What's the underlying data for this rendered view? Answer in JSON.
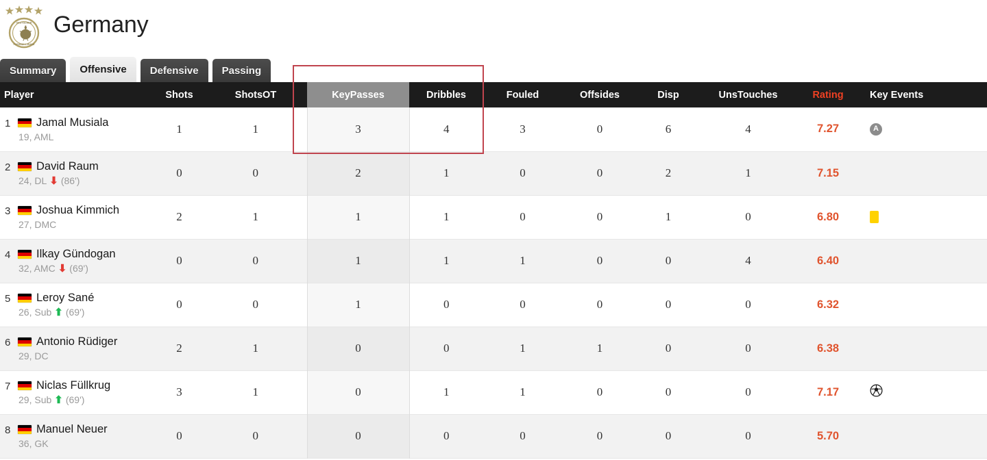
{
  "header": {
    "team": "Germany",
    "crest_icon": "germany-dfb-crest-icon",
    "stars": "★★★★"
  },
  "tabs": [
    {
      "label": "Summary",
      "active": false
    },
    {
      "label": "Offensive",
      "active": true
    },
    {
      "label": "Defensive",
      "active": false
    },
    {
      "label": "Passing",
      "active": false
    }
  ],
  "colors": {
    "header_bg": "#1c1c1c",
    "rating_accent": "#ef4123",
    "rating_value": "#e0542e",
    "highlight_header_bg": "#8e8e8e",
    "annotation_border": "#c0444e",
    "yellow_card": "#ffd200",
    "assist_badge": "#8c8c8c",
    "sub_off_arrow": "#e23a33",
    "sub_on_arrow": "#1db954"
  },
  "table": {
    "columns": [
      "Player",
      "Shots",
      "ShotsOT",
      "KeyPasses",
      "Dribbles",
      "Fouled",
      "Offsides",
      "Disp",
      "UnsTouches",
      "Rating",
      "Key Events"
    ],
    "highlighted_column": "KeyPasses",
    "rows": [
      {
        "rank": "1",
        "name": "Jamal Musiala",
        "age": "19",
        "position": "AML",
        "sub": null,
        "sub_minute": null,
        "shots": "1",
        "shots_ot": "1",
        "key_passes": "3",
        "dribbles": "4",
        "fouled": "3",
        "offsides": "0",
        "disp": "6",
        "uns_touches": "4",
        "rating": "7.27",
        "key_events": [
          "assist"
        ]
      },
      {
        "rank": "2",
        "name": "David Raum",
        "age": "24",
        "position": "DL",
        "sub": "off",
        "sub_minute": "(86')",
        "shots": "0",
        "shots_ot": "0",
        "key_passes": "2",
        "dribbles": "1",
        "fouled": "0",
        "offsides": "0",
        "disp": "2",
        "uns_touches": "1",
        "rating": "7.15",
        "key_events": []
      },
      {
        "rank": "3",
        "name": "Joshua Kimmich",
        "age": "27",
        "position": "DMC",
        "sub": null,
        "sub_minute": null,
        "shots": "2",
        "shots_ot": "1",
        "key_passes": "1",
        "dribbles": "1",
        "fouled": "0",
        "offsides": "0",
        "disp": "1",
        "uns_touches": "0",
        "rating": "6.80",
        "key_events": [
          "yellow-card"
        ]
      },
      {
        "rank": "4",
        "name": "Ilkay Gündogan",
        "age": "32",
        "position": "AMC",
        "sub": "off",
        "sub_minute": "(69')",
        "shots": "0",
        "shots_ot": "0",
        "key_passes": "1",
        "dribbles": "1",
        "fouled": "1",
        "offsides": "0",
        "disp": "0",
        "uns_touches": "4",
        "rating": "6.40",
        "key_events": []
      },
      {
        "rank": "5",
        "name": "Leroy Sané",
        "age": "26",
        "position": "Sub",
        "sub": "on",
        "sub_minute": "(69')",
        "shots": "0",
        "shots_ot": "0",
        "key_passes": "1",
        "dribbles": "0",
        "fouled": "0",
        "offsides": "0",
        "disp": "0",
        "uns_touches": "0",
        "rating": "6.32",
        "key_events": []
      },
      {
        "rank": "6",
        "name": "Antonio Rüdiger",
        "age": "29",
        "position": "DC",
        "sub": null,
        "sub_minute": null,
        "shots": "2",
        "shots_ot": "1",
        "key_passes": "0",
        "dribbles": "0",
        "fouled": "1",
        "offsides": "1",
        "disp": "0",
        "uns_touches": "0",
        "rating": "6.38",
        "key_events": []
      },
      {
        "rank": "7",
        "name": "Niclas Füllkrug",
        "age": "29",
        "position": "Sub",
        "sub": "on",
        "sub_minute": "(69')",
        "shots": "3",
        "shots_ot": "1",
        "key_passes": "0",
        "dribbles": "1",
        "fouled": "1",
        "offsides": "0",
        "disp": "0",
        "uns_touches": "0",
        "rating": "7.17",
        "key_events": [
          "goal"
        ]
      },
      {
        "rank": "8",
        "name": "Manuel Neuer",
        "age": "36",
        "position": "GK",
        "sub": null,
        "sub_minute": null,
        "shots": "0",
        "shots_ot": "0",
        "key_passes": "0",
        "dribbles": "0",
        "fouled": "0",
        "offsides": "0",
        "disp": "0",
        "uns_touches": "0",
        "rating": "5.70",
        "key_events": []
      }
    ]
  }
}
